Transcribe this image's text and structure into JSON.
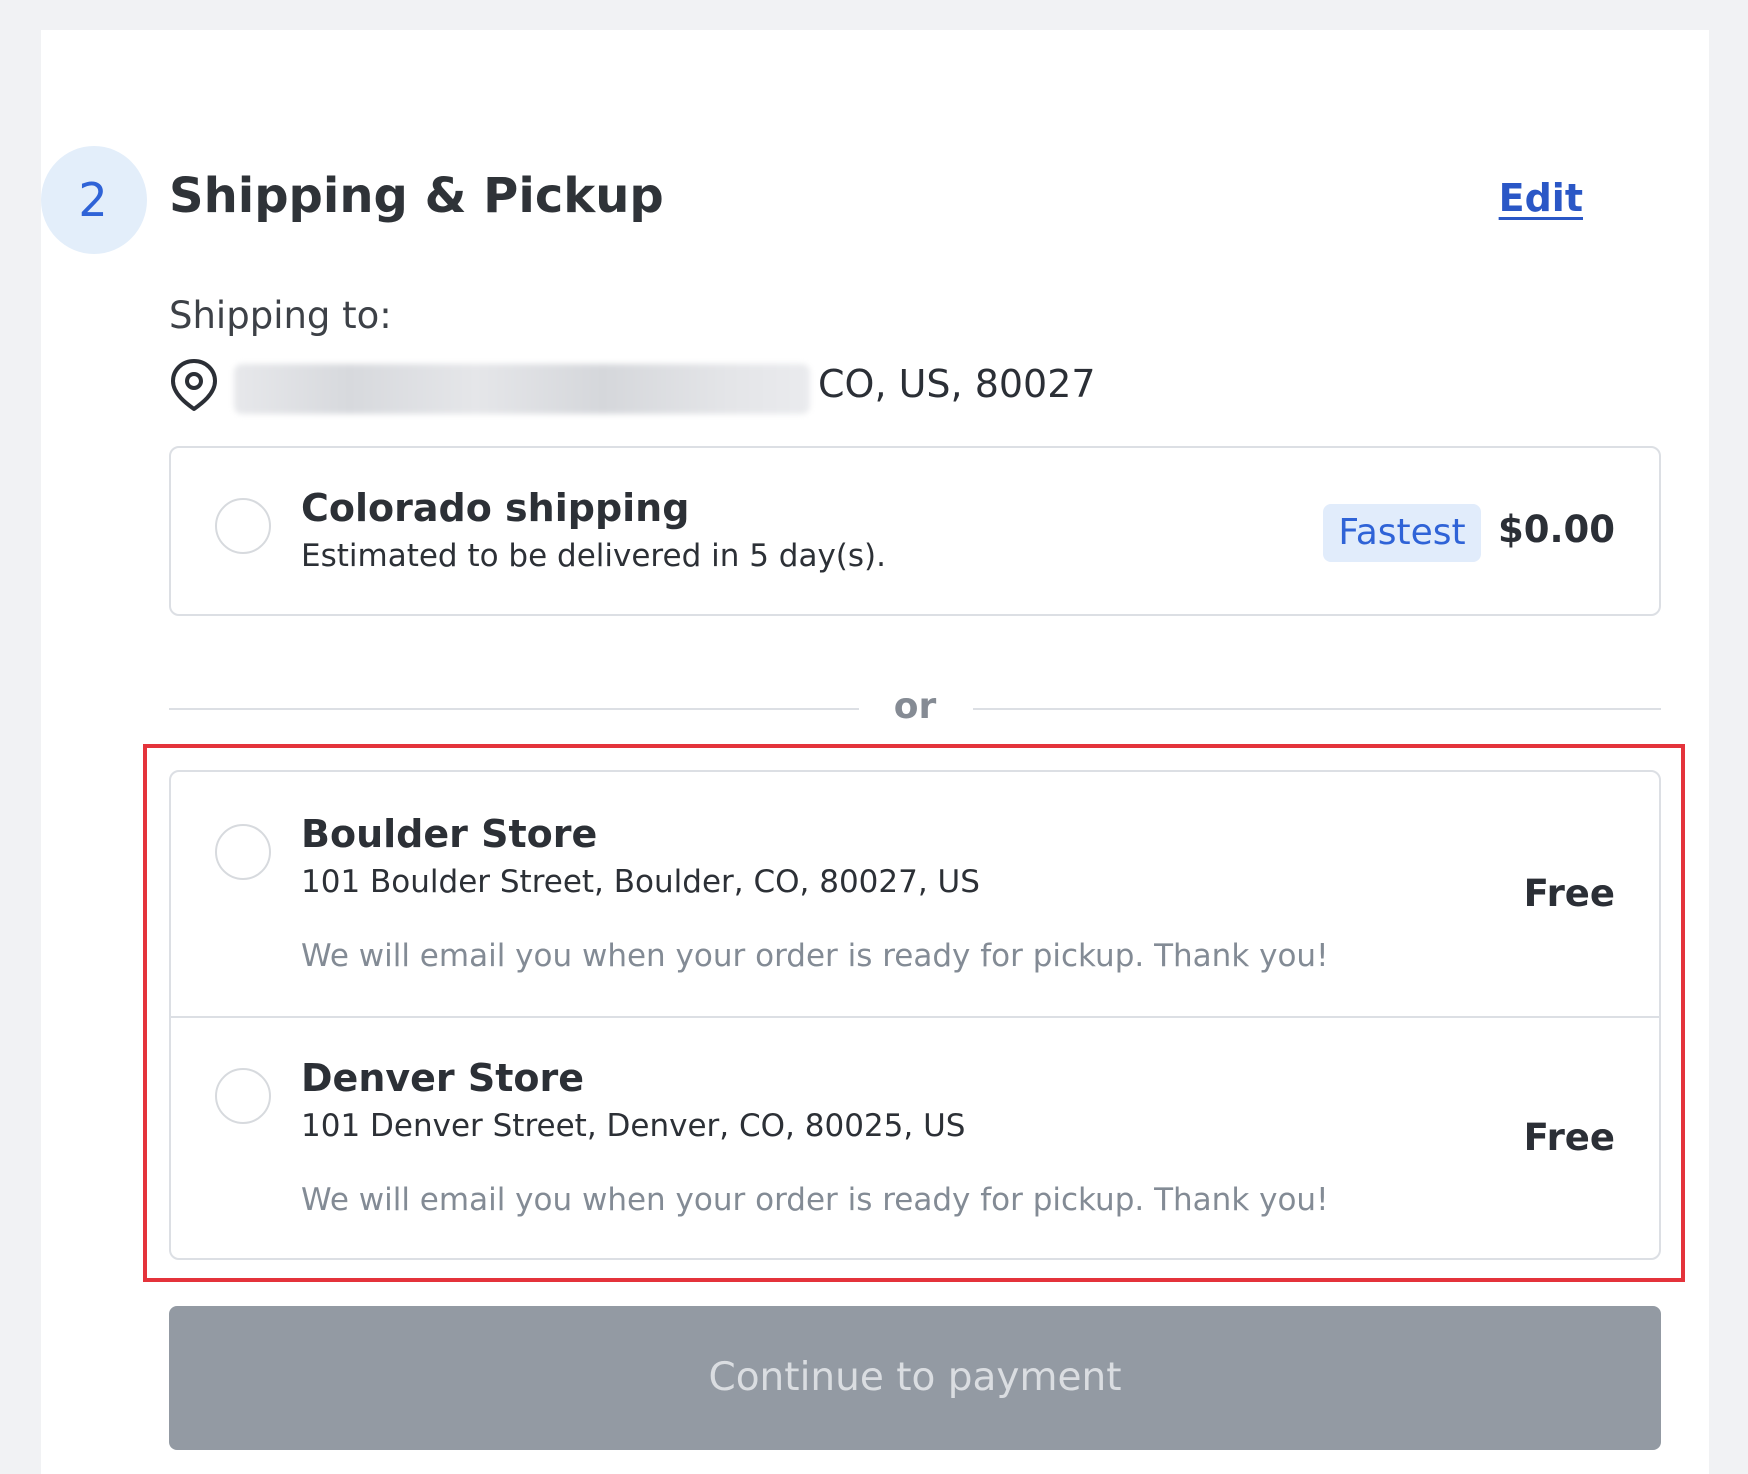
{
  "step": {
    "number": "2",
    "title": "Shipping & Pickup",
    "edit_label": "Edit"
  },
  "shipping_to": {
    "label": "Shipping to:",
    "address_visible": "CO, US, 80027",
    "icon": "location-pin-icon"
  },
  "shipping_options": [
    {
      "title": "Colorado shipping",
      "subtitle": "Estimated to be delivered in 5 day(s).",
      "badge": "Fastest",
      "price": "$0.00",
      "selected": false
    }
  ],
  "divider_label": "or",
  "pickup_options": [
    {
      "title": "Boulder Store",
      "address": "101 Boulder Street, Boulder, CO, 80027, US",
      "note": "We will email you when your order is ready for pickup. Thank you!",
      "price": "Free",
      "selected": false
    },
    {
      "title": "Denver Store",
      "address": "101 Denver Street, Denver, CO, 80025, US",
      "note": "We will email you when your order is ready for pickup. Thank you!",
      "price": "Free",
      "selected": false
    }
  ],
  "continue_label": "Continue to payment",
  "colors": {
    "accent": "#2f63d7",
    "link": "#2a57c6",
    "badge_bg": "#e1ecfb",
    "highlight": "#e4333b",
    "button_disabled": "#939aa3"
  }
}
